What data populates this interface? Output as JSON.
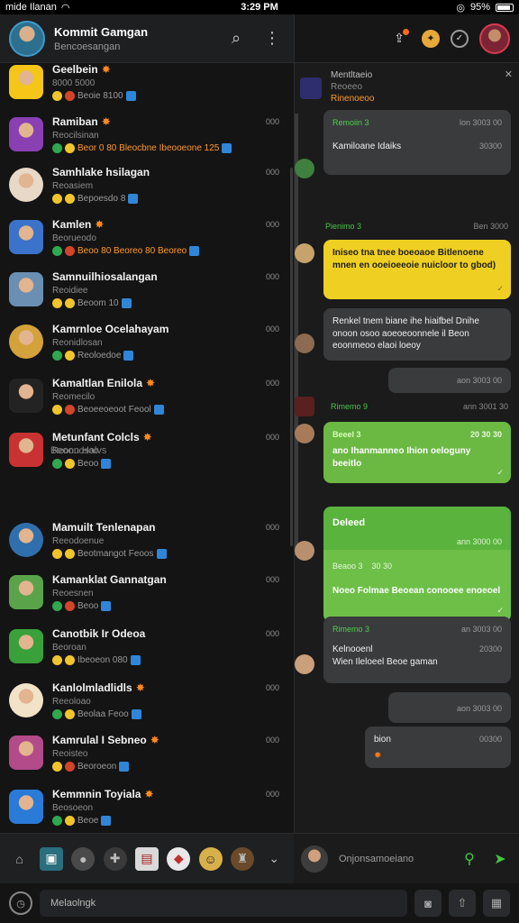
{
  "statusbar": {
    "carrier": "mide Ilanan",
    "time": "3:29 PM",
    "signal": "95%",
    "battery_level": 0.8
  },
  "left_header": {
    "title": "Kommit Gamgan",
    "subtitle": "Bencoesangan",
    "search_icon": "search-icon",
    "more_icon": "more-vertical-icon"
  },
  "chats": [
    {
      "name": "Geelbein",
      "flag": "fire",
      "sub": "8000 5000",
      "meta": "Beoie 8100",
      "time": "",
      "color": "#f5c518"
    },
    {
      "name": "Ramiban",
      "flag": "fire",
      "sub": "Reocilsinan",
      "meta": "Beor 0 80 Bleocbne Ibeooeone 125",
      "time": "000",
      "color": "#8a3fb3"
    },
    {
      "name": "Samhlake hsilagan",
      "flag": "",
      "sub": "Reoasiem",
      "meta": "Bepoesdo 8",
      "time": "000",
      "color": "#e8d8c8"
    },
    {
      "name": "Kamlen",
      "flag": "fire",
      "sub": "Beorueodo",
      "meta": "Beoo 80 Beoreo 80 Beoreo",
      "time": "000",
      "color": "#3a73c9"
    },
    {
      "name": "Samnuilhiosalangan",
      "flag": "",
      "sub": "Reoidiee",
      "meta": "Beoom 10",
      "time": "000",
      "color": "#6b8fb3"
    },
    {
      "name": "Kamrnloe Ocelahayam",
      "flag": "",
      "sub": "Reonidlosan",
      "meta": "Reoloedoe",
      "time": "000",
      "color": "#d4a23a"
    },
    {
      "name": "Kamaltlan Enilola",
      "flag": "fire",
      "sub": "Reomecilo",
      "meta": "Beoeeoeoot Feool",
      "time": "000",
      "color": "#232323"
    },
    {
      "name": "Metunfant Colcls",
      "flag": "fire",
      "sub": "Reonuosoo",
      "meta": "Beoo",
      "time": "000",
      "color": "#c83232"
    },
    {
      "name": "Mamuilt Tenlenapan",
      "flag": "",
      "sub": "Reeodoenue",
      "meta": "Beotmangot Feoos",
      "time": "000",
      "color": "#2f6fae"
    },
    {
      "name": "Kamanklat Gannatgan",
      "flag": "",
      "sub": "Reoesnen",
      "meta": "Beoo",
      "time": "000",
      "color": "#5aa34a"
    },
    {
      "name": "Canotbik Ir Odeoa",
      "flag": "",
      "sub": "Beoroan",
      "meta": "Ibeoeon 080",
      "time": "000",
      "color": "#3aa03a"
    },
    {
      "name": "Kanlolmladlidls",
      "flag": "fire",
      "sub": "Reeoloao",
      "meta": "Beolaa Feoo",
      "time": "000",
      "color": "#f1e2c8"
    },
    {
      "name": "Kamrulal I Sebneo",
      "flag": "fire",
      "sub": "Reoisteo",
      "meta": "Beoroeon",
      "time": "000",
      "color": "#b34a8a"
    },
    {
      "name": "Kemmnin Toyiala",
      "flag": "fire",
      "sub": "Beosoeon",
      "meta": "Beoe",
      "time": "000",
      "color": "#2a7ad8"
    }
  ],
  "section_label": "Beoon Halvs",
  "right_header": {
    "notif_icon": "share-icon",
    "badge_icon": "star-badge-icon",
    "ring_icon": "check-circle-icon"
  },
  "pinned": {
    "title": "Mentltaeio",
    "sub": "Reoeeo",
    "sub2": "Rinenoeoo"
  },
  "messages": [
    {
      "kind": "dark",
      "who": "Remoiin 3",
      "stamp": "lon 3003 00",
      "text": "Kamiloane Idaiks",
      "time2": "30300"
    },
    {
      "kind": "label",
      "who": "Pienimo 3",
      "stamp": "Ben 3000"
    },
    {
      "kind": "yellow",
      "text": "Iniseo tna tnee boeoaoe Bitlenoene mnen en ooeioeeoie nuicloor to gbod)"
    },
    {
      "kind": "dark",
      "text": "Renkel tnem biane ihe hiaifbel Dnihe onoon osoo aoeoeoonnele il Beon eoonmeoo elaoi loeoy"
    },
    {
      "kind": "dark",
      "stamp": "aon 3003 00"
    },
    {
      "kind": "label",
      "who": "Rimemo 9",
      "stamp": "ann 3001 30"
    },
    {
      "kind": "green",
      "who": "Beeel 3",
      "stamp": "20 30 30",
      "text": "ano Ihanmanneo Ihion oeloguny beeitlo"
    },
    {
      "kind": "dark",
      "stamp": ""
    }
  ],
  "green_card": {
    "title": "Deleed",
    "stamp": "ann 3000 00",
    "head": "Beaoo 3",
    "head_stamp": "30 30",
    "text": "Noeo Folmae Beoean conooee enoeoel"
  },
  "last_messages": [
    {
      "who": "Rimemo 3",
      "stamp": "an 3003 00",
      "text": "Kelnooenl",
      "text2": "Wien Ileloeel Beoe gaman",
      "time": "20300"
    },
    {
      "stamp": "aon 3003 00"
    },
    {
      "text": "bion",
      "time": "00300"
    }
  ],
  "composer": {
    "placeholder": "Onjonsamoeiano"
  },
  "bottom": {
    "placeholder": "Melaolngk"
  }
}
